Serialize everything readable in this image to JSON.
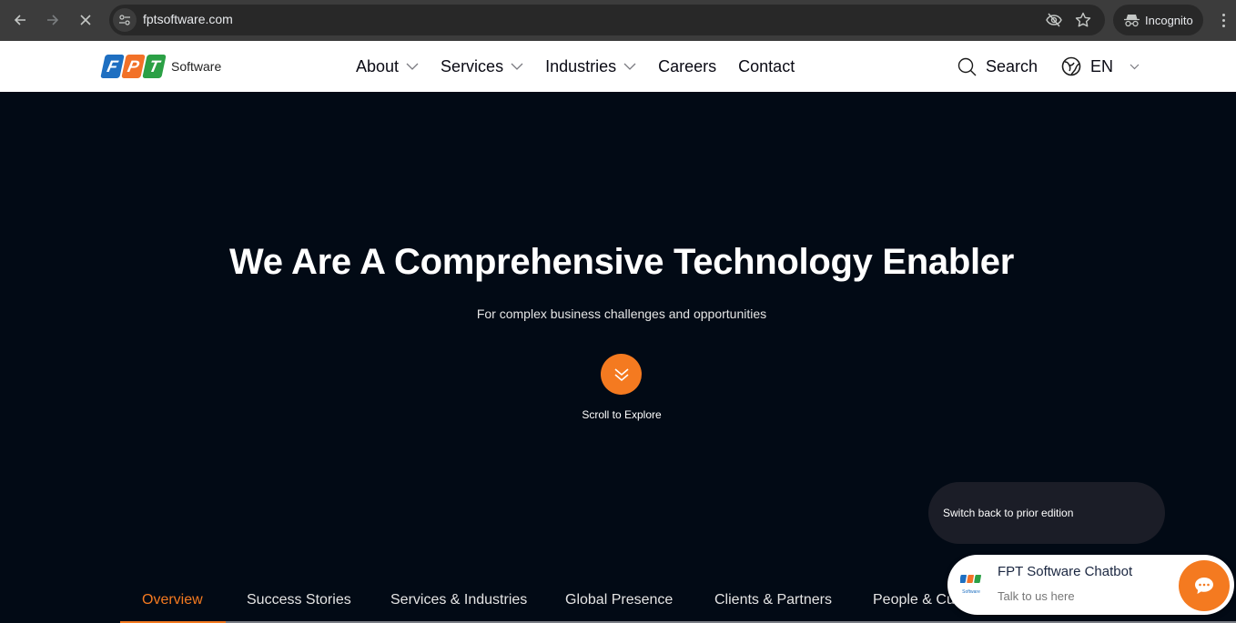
{
  "browser": {
    "url": "fptsoftware.com",
    "profile_label": "Incognito",
    "icons": [
      "back-icon",
      "forward-icon",
      "stop-loading-icon",
      "site-info-icon",
      "eye-off-icon",
      "bookmark-star-icon",
      "incognito-icon",
      "more-menu-icon"
    ]
  },
  "header": {
    "logo": {
      "letters": [
        "F",
        "P",
        "T"
      ],
      "word": "Software",
      "colors": {
        "blue": "#1e6fc1",
        "orange": "#f27128",
        "green": "#2ba045"
      }
    },
    "nav": [
      {
        "label": "About",
        "has_dropdown": true
      },
      {
        "label": "Services",
        "has_dropdown": true
      },
      {
        "label": "Industries",
        "has_dropdown": true
      },
      {
        "label": "Careers",
        "has_dropdown": false
      },
      {
        "label": "Contact",
        "has_dropdown": false
      }
    ],
    "search_label": "Search",
    "language": "EN"
  },
  "hero": {
    "title": "We Are A Comprehensive Technology Enabler",
    "subtitle": "For complex business challenges and opportunities",
    "scroll_label": "Scroll to Explore"
  },
  "edition_switch": {
    "label": "Switch back to prior edition",
    "on": true
  },
  "section_tabs": {
    "active_index": 0,
    "items": [
      {
        "label": "Overview"
      },
      {
        "label": "Success Stories"
      },
      {
        "label": "Services & Industries"
      },
      {
        "label": "Global Presence"
      },
      {
        "label": "Clients & Partners"
      },
      {
        "label": "People & Culture"
      }
    ]
  },
  "chatbot": {
    "title": "FPT Software Chatbot",
    "subtitle": "Talk to us here",
    "logo_caption": "Software"
  },
  "colors": {
    "accent": "#f47a20",
    "background": "#020a15",
    "chrome": "#3c3c3c"
  }
}
